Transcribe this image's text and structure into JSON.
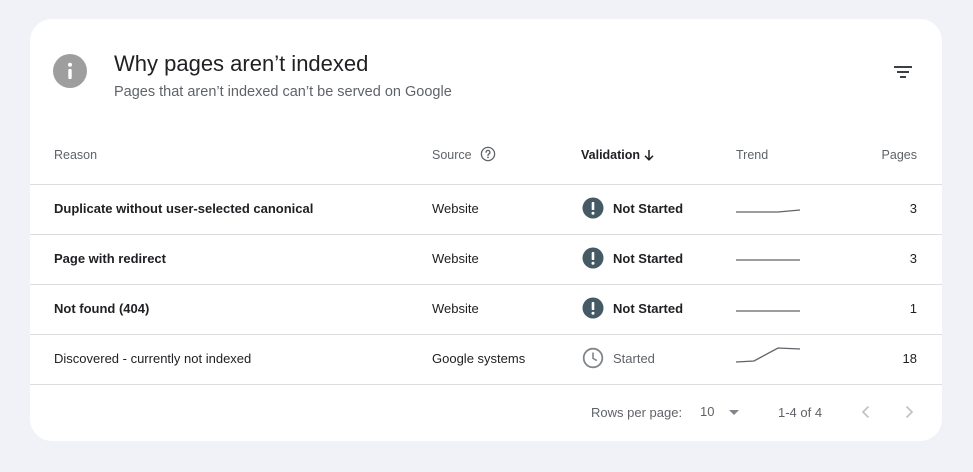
{
  "header": {
    "title": "Why pages aren’t indexed",
    "subtitle": "Pages that aren’t indexed can’t be served on Google"
  },
  "columns": {
    "reason": "Reason",
    "source": "Source",
    "validation": "Validation",
    "trend": "Trend",
    "pages": "Pages"
  },
  "rows": [
    {
      "reason": "Duplicate without user-selected canonical",
      "source": "Website",
      "validation": "Not Started",
      "pages": "3"
    },
    {
      "reason": "Page with redirect",
      "source": "Website",
      "validation": "Not Started",
      "pages": "3"
    },
    {
      "reason": "Not found (404)",
      "source": "Website",
      "validation": "Not Started",
      "pages": "1"
    },
    {
      "reason": "Discovered - currently not indexed",
      "source": "Google systems",
      "validation": "Started",
      "pages": "18"
    }
  ],
  "footer": {
    "rows_per_page_label": "Rows per page:",
    "rows_per_page_value": "10",
    "range": "1-4 of 4"
  },
  "colors": {
    "not_started_icon": "#455a64",
    "started_icon": "#80868b",
    "info_icon": "#9e9e9e",
    "divider": "#dadce0"
  }
}
